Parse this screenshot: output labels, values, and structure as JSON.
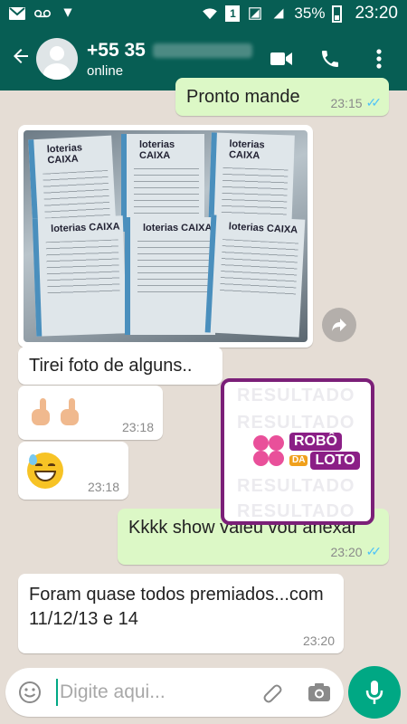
{
  "status_bar": {
    "battery": "35%",
    "time": "23:20",
    "sim_label": "1"
  },
  "header": {
    "contact_name": "+55 35",
    "contact_status": "online"
  },
  "messages": [
    {
      "direction": "outgoing",
      "text": "Pronto mande",
      "time": "23:15"
    },
    {
      "direction": "incoming",
      "type": "image",
      "caption": "Tirei foto de alguns.."
    },
    {
      "direction": "incoming",
      "type": "emoji",
      "emoji": "pointing-up-hands",
      "time": "23:18"
    },
    {
      "direction": "incoming",
      "type": "emoji",
      "emoji": "sweat-smile",
      "time": "23:18"
    },
    {
      "direction": "outgoing",
      "text": "Kkkk show valeu vou anexar",
      "time": "23:20"
    },
    {
      "direction": "incoming",
      "text": "Foram quase todos premiados...com 11/12/13 e 14",
      "time": "23:20"
    }
  ],
  "photo": {
    "ticket_brand": "loterias CAIXA"
  },
  "watermark": {
    "lines": [
      "RESULTADO",
      "RESULTADO",
      "RESULTADO",
      "RESULTADO"
    ],
    "logo_top": "ROBÔ",
    "logo_da": "DA",
    "logo_bottom": "LOTO"
  },
  "input": {
    "placeholder": "Digite aqui..."
  },
  "colors": {
    "header": "#075e54",
    "outgoing_bubble": "#dcf8c6",
    "incoming_bubble": "#ffffff",
    "accent": "#00a884",
    "read_ticks": "#4fc3f7",
    "watermark_border": "#7b1f78"
  }
}
